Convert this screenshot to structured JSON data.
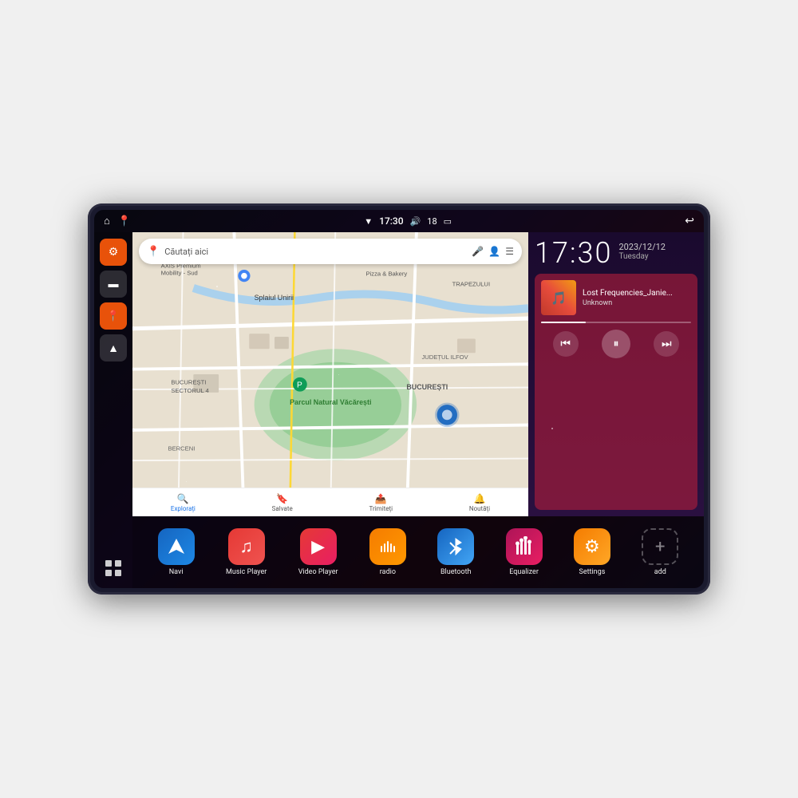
{
  "device": {
    "status_bar": {
      "wifi_icon": "▼",
      "time": "17:30",
      "volume_icon": "🔊",
      "battery_level": "18",
      "battery_icon": "🔋",
      "back_icon": "↩"
    },
    "sidebar": {
      "home_icon": "⌂",
      "map_icon": "📍",
      "settings_icon": "⚙",
      "folder_icon": "📁",
      "location_icon": "📍",
      "navi_icon": "▲",
      "grid_icon": "⊞"
    },
    "map": {
      "search_placeholder": "Căutați aici",
      "places": [
        "AXIS Premium Mobility - Sud",
        "Pizza & Bakery",
        "TRAPEZULUI",
        "Parcul Natural Văcărești",
        "BUCUREȘTI",
        "JUDEȚUL ILFOV",
        "BUCUREȘTI SECTORUL 4",
        "BERCENI"
      ],
      "bottom_items": [
        {
          "label": "Explorați",
          "icon": "🔍"
        },
        {
          "label": "Salvate",
          "icon": "🔖"
        },
        {
          "label": "Trimiteți",
          "icon": "📤"
        },
        {
          "label": "Noutăți",
          "icon": "🔔"
        }
      ]
    },
    "clock": {
      "time": "17:30",
      "date": "2023/12/12",
      "day": "Tuesday"
    },
    "music": {
      "track_name": "Lost Frequencies_Janie...",
      "artist": "Unknown",
      "controls": {
        "prev_label": "⏮",
        "play_label": "⏸",
        "next_label": "⏭"
      }
    },
    "apps": [
      {
        "id": "navi",
        "label": "Navi",
        "icon": "▲",
        "class": "app-navi"
      },
      {
        "id": "music-player",
        "label": "Music Player",
        "icon": "♫",
        "class": "app-music"
      },
      {
        "id": "video-player",
        "label": "Video Player",
        "icon": "▶",
        "class": "app-video"
      },
      {
        "id": "radio",
        "label": "radio",
        "icon": "📻",
        "class": "app-radio"
      },
      {
        "id": "bluetooth",
        "label": "Bluetooth",
        "icon": "⚡",
        "class": "app-bluetooth"
      },
      {
        "id": "equalizer",
        "label": "Equalizer",
        "icon": "🎚",
        "class": "app-equalizer"
      },
      {
        "id": "settings",
        "label": "Settings",
        "icon": "⚙",
        "class": "app-settings"
      },
      {
        "id": "add",
        "label": "add",
        "icon": "+",
        "class": "app-add"
      }
    ]
  }
}
